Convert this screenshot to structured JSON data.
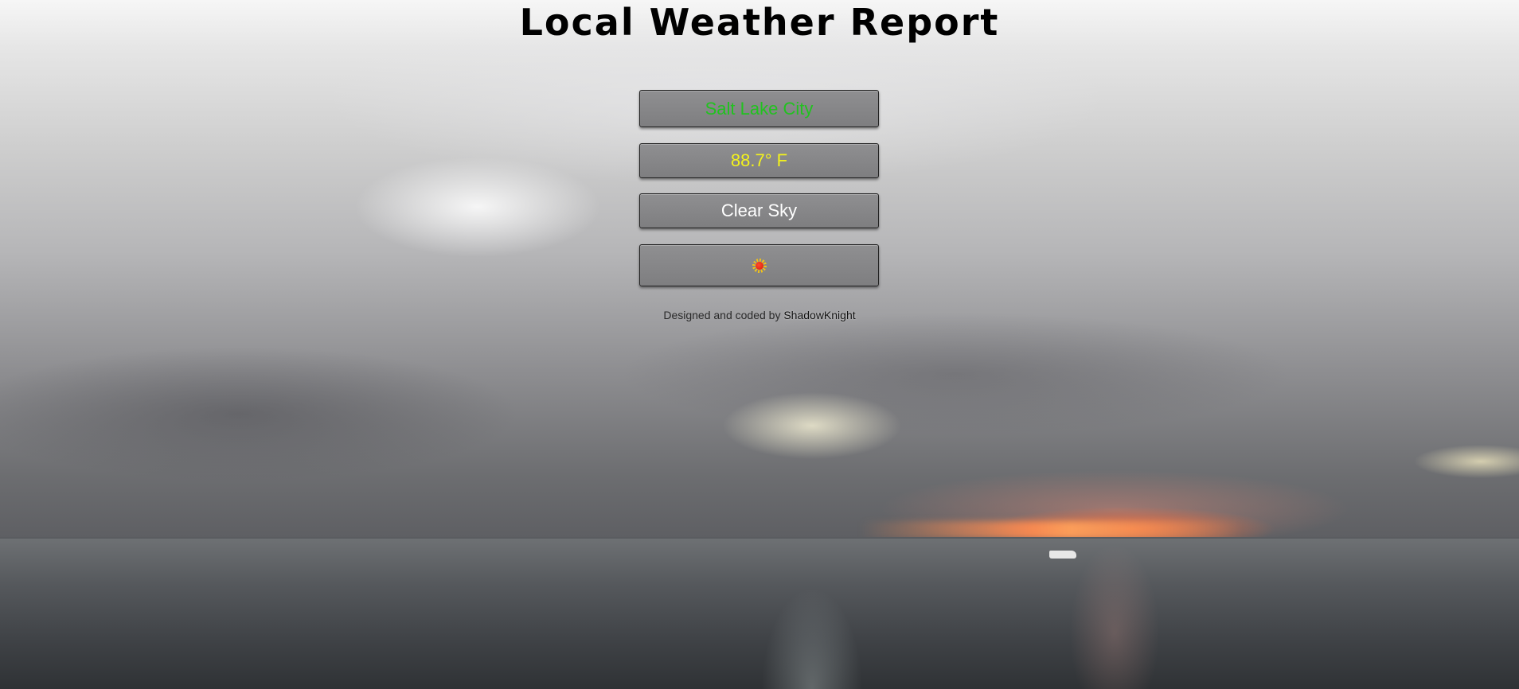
{
  "page": {
    "title": "Local Weather Report"
  },
  "weather": {
    "city": "Salt Lake City",
    "temperature": "88.7° F",
    "condition": "Clear Sky",
    "icon": "sun-icon"
  },
  "footer": {
    "credit_prefix": "Designed and coded by",
    "author": "ShadowKnight"
  },
  "colors": {
    "city_text": "#21c21f",
    "temperature_text": "#f3f21c",
    "condition_text": "#ffffff",
    "panel_bg": "#878789"
  }
}
